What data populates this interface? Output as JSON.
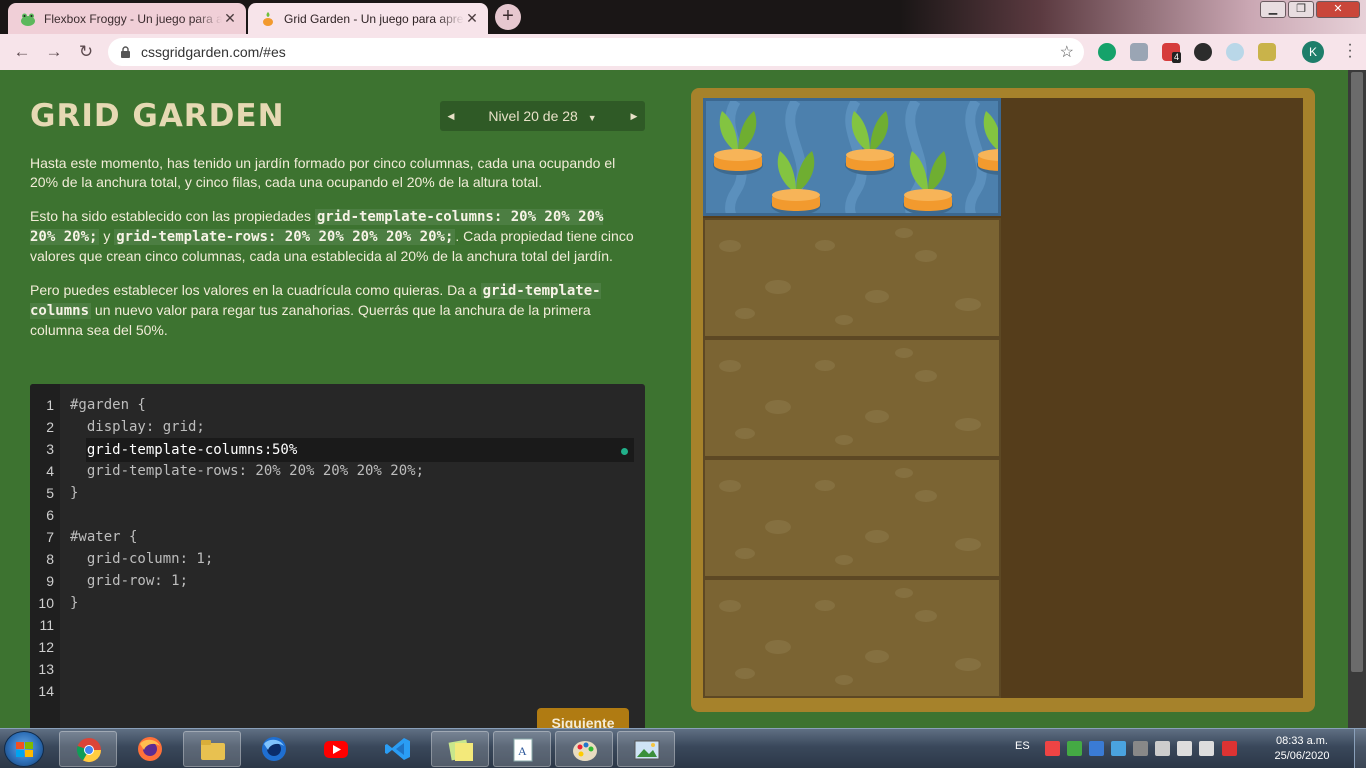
{
  "browser": {
    "tabs": [
      {
        "title": "Flexbox Froggy - Un juego para a",
        "active": false
      },
      {
        "title": "Grid Garden - Un juego para apre",
        "active": true
      }
    ],
    "url": "cssgridgarden.com/#es",
    "profile_initial": "K",
    "extension_badge": "4"
  },
  "page": {
    "title": "GRID GARDEN",
    "level_label": "Nivel 20 de 28",
    "paragraph1": "Hasta este momento, has tenido un jardín formado por cinco columnas, cada una ocupando el 20% de la anchura total, y cinco filas, cada una ocupando el 20% de la altura total.",
    "paragraph2": {
      "t1": "Esto ha sido establecido con las propiedades ",
      "c1": "grid-template-columns: 20% 20% 20% 20% 20%;",
      "t2": " y ",
      "c2": "grid-template-rows: 20% 20% 20% 20% 20%;",
      "t3": ". Cada propiedad tiene cinco valores que crean cinco columnas, cada una establecida al 20% de la anchura total del jardín."
    },
    "paragraph3": {
      "t1": "Pero puedes establecer los valores en la cuadrícula como quieras. Da a ",
      "c1": "grid-template-columns",
      "t2": " un nuevo valor para regar tus zanahorias. Querrás que la anchura de la primera columna sea del 50%."
    },
    "next_button": "Siguiente"
  },
  "editor": {
    "line_numbers": [
      "1",
      "2",
      "3",
      "4",
      "5",
      "6",
      "7",
      "8",
      "9",
      "10",
      "11",
      "12",
      "13",
      "14"
    ],
    "lines": [
      "#garden {",
      "  display: grid;",
      "  grid-template-columns: ",
      "  grid-template-rows: 20% 20% 20% 20% 20%;",
      "}",
      "",
      "#water {",
      "  grid-column: 1;",
      "  grid-row: 1;",
      "}",
      "",
      "",
      "",
      ""
    ],
    "answer_value": "50%"
  },
  "taskbar": {
    "lang": "ES",
    "time": "08:33 a.m.",
    "date": "25/06/2020",
    "apps": [
      "chrome",
      "firefox",
      "file-explorer",
      "firefox-developer",
      "youtube",
      "vscode",
      "sticky-notes",
      "word-document",
      "paint",
      "photo-viewer"
    ]
  },
  "colors": {
    "page_bg": "#3d7330",
    "title": "#e6d9b3",
    "editor_bg": "#272727",
    "water": "#4c80ad",
    "soil": "#7b6433",
    "next_button": "#b07b12"
  }
}
